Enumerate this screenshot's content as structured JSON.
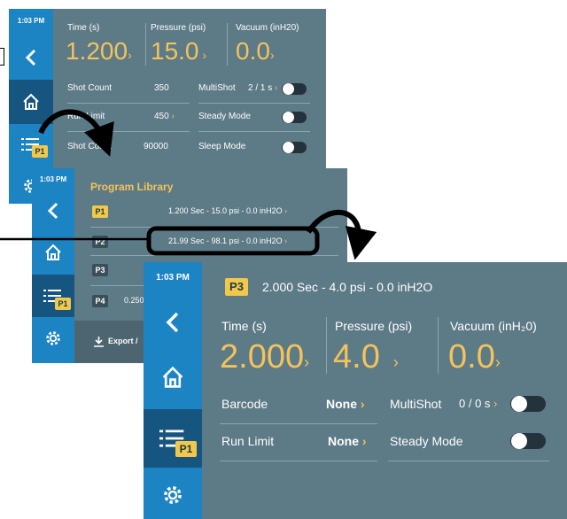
{
  "panel1": {
    "time": "1:03 PM",
    "labels": {
      "time": "Time (s)",
      "pressure": "Pressure (psi)",
      "vacuum": "Vacuum (inH20)"
    },
    "values": {
      "time": "1.200",
      "pressure": "15.0",
      "vacuum": "0.0"
    },
    "rows": {
      "shot_count_label": "Shot Count",
      "shot_count_value": "350",
      "multishot_label": "MultiShot",
      "multishot_value": "2 / 1 s",
      "run_limit_label": "Run Limit",
      "run_limit_value": "450",
      "steady_label": "Steady Mode",
      "shot_total_label": "Shot Count",
      "shot_total_value": "90000",
      "sleep_label": "Sleep Mode"
    },
    "badge": "P1"
  },
  "panel2": {
    "time": "1:03 PM",
    "title": "Program Library",
    "programs": [
      {
        "id": "P1",
        "desc": "1.200 Sec - 15.0 psi - 0.0 inH2O"
      },
      {
        "id": "P2",
        "desc": "21.99 Sec - 98.1 psi - 0.0 inH2O"
      },
      {
        "id": "P3",
        "desc": ""
      },
      {
        "id": "P4",
        "desc": "0.250"
      }
    ],
    "export_label": "Export /",
    "badge": "P1"
  },
  "panel3": {
    "time": "1:03 PM",
    "program_badge": "P3",
    "program_summary": "2.000 Sec - 4.0 psi - 0.0 inH2O",
    "labels": {
      "time": "Time (s)",
      "pressure": "Pressure (psi)",
      "vacuum": "Vacuum (inH₂0)"
    },
    "values": {
      "time": "2.000",
      "pressure": "4.0",
      "vacuum": "0.0"
    },
    "rows": {
      "barcode_label": "Barcode",
      "barcode_value": "None",
      "multishot_label": "MultiShot",
      "multishot_value": "0 / 0 s",
      "run_limit_label": "Run Limit",
      "run_limit_value": "None",
      "steady_label": "Steady Mode"
    },
    "badge": "P1"
  },
  "colors": {
    "panel_bg": "#5d7a87",
    "sidebar": "#1d84c4",
    "sidebar_active": "#16557f",
    "accent": "#f4c35a",
    "badge": "#f2c84b"
  },
  "icons": [
    "back-chevron-icon",
    "home-icon",
    "program-list-icon",
    "gear-icon",
    "download-icon",
    "curved-arrow-icon"
  ]
}
